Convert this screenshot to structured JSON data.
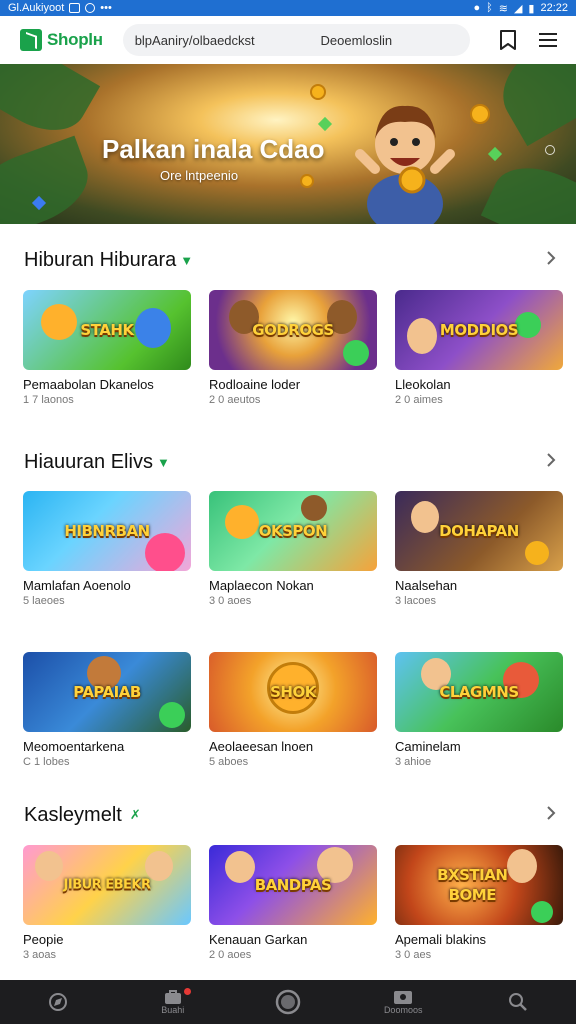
{
  "status_bar": {
    "left_text": "Gl.Aukiyoot",
    "time": "22:22",
    "colors": {
      "bar": "#1f6fd1"
    }
  },
  "header": {
    "app_name": "Shoplн",
    "search_query": "blpAaniry/olbaedckst",
    "search_right": "Deoemloslin",
    "icons": [
      "bookmark-icon",
      "menu-icon"
    ]
  },
  "hero": {
    "title": "Palkan inala Cdao",
    "subtitle": "Ore lntpeenio"
  },
  "sections": [
    {
      "title": "Hiburan Hiburara",
      "items": [
        {
          "thumb_text": "STAHK",
          "name": "Pemaabolan Dkanelos",
          "meta": "1 7 laonos"
        },
        {
          "thumb_text": "GODROGS",
          "name": "Rodloaine loder",
          "meta": "2 0 aeutos"
        },
        {
          "thumb_text": "MODDIOS",
          "name": "Lleokolan",
          "meta": "2 0 aimes"
        }
      ]
    },
    {
      "title": "Hiauuran Elivs",
      "items": [
        {
          "thumb_text": "HIBNRBAN",
          "name": "Mamlafan Aoenolo",
          "meta": "5 laeoes"
        },
        {
          "thumb_text": "OKSPON",
          "name": "Maplaecon Nokan",
          "meta": "3 0 aoes"
        },
        {
          "thumb_text": "DOHAPAN",
          "name": "Naalsehan",
          "meta": "3 lacoes"
        }
      ]
    },
    {
      "items": [
        {
          "thumb_text": "PAPAIAB",
          "name": "Meomoentarkena",
          "meta": "C 1 lobes"
        },
        {
          "thumb_text": "SHOK",
          "name": "Aeolaeesan lnoen",
          "meta": "5 aboes"
        },
        {
          "thumb_text": "CLAGMNS",
          "name": "Caminelam",
          "meta": "3 ahioe"
        }
      ]
    },
    {
      "title": "Kasleymelt",
      "items": [
        {
          "thumb_text": "JIBUR EBEKR",
          "name": "Peopie",
          "meta": "3 aoas"
        },
        {
          "thumb_text": "BANDPAS",
          "name": "Kenauan Garkan",
          "meta": "2 0 aoes"
        },
        {
          "thumb_text": "BXSTIAN BOME",
          "name": "Apemali blakins",
          "meta": "3 0 aes"
        }
      ]
    }
  ],
  "bottom_nav": {
    "items": [
      {
        "icon": "explore-icon",
        "label": ""
      },
      {
        "icon": "bag-icon",
        "label": "Buahi"
      },
      {
        "icon": "home-circle-icon",
        "label": ""
      },
      {
        "icon": "store-icon",
        "label": "Doomoos"
      },
      {
        "icon": "search-icon",
        "label": ""
      }
    ]
  },
  "colors": {
    "accent": "#1aa24b",
    "nav_bg": "#1d1d1f"
  }
}
